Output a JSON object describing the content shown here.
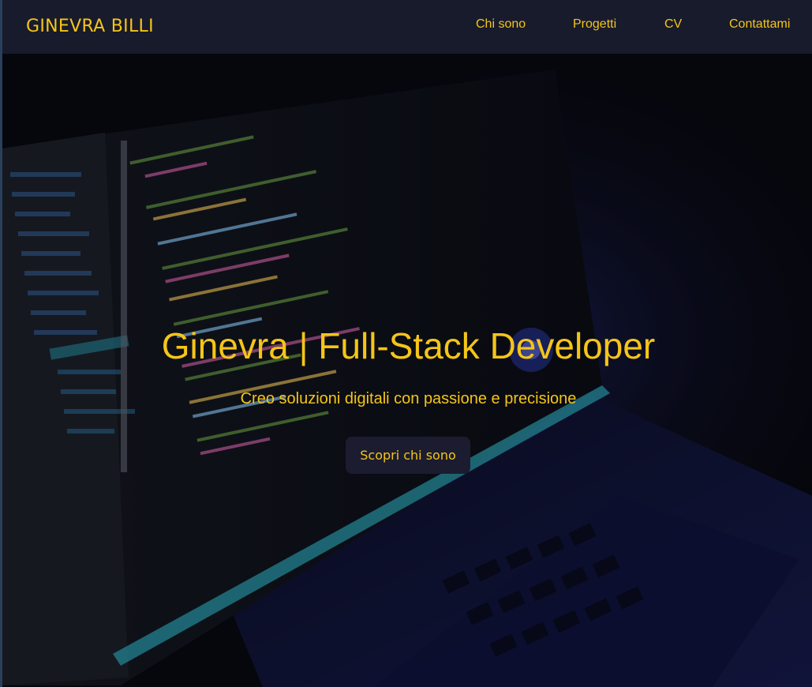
{
  "navbar": {
    "brand": "GINEVRA BILLI",
    "links": [
      "Chi sono",
      "Progetti",
      "CV",
      "Contattami"
    ]
  },
  "hero": {
    "title": "Ginevra | Full-Stack Developer",
    "subtitle": "Creo soluzioni digitali con passione e precisione",
    "button_label": "Scopri chi sono",
    "background_image": "laptop-code-editor-photo"
  },
  "colors": {
    "accent": "#f5c518",
    "navbar_bg": "#181b2c",
    "button_bg": "#1b1c30",
    "page_bg": "#07080d"
  }
}
